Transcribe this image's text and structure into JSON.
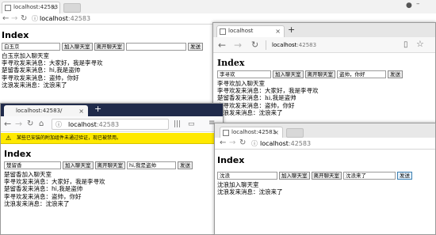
{
  "chrome_window": {
    "tab_title": "localhost:42583",
    "url": {
      "host": "localhost",
      "port": ":42583"
    },
    "page": {
      "title": "Index",
      "input_value": "白玉京",
      "join_label": "加入聊天室",
      "leave_label": "离开聊天室",
      "message_value": "",
      "send_label": "发送",
      "messages": [
        "白玉京加入聊天室",
        "李寻欢发来消息：大家好，我是李寻欢",
        "楚留香发来消息：hi,我是盗帅",
        "李寻欢发来消息：盗帅，你好",
        "沈浪发来消息：沈浪来了"
      ]
    }
  },
  "edge_window": {
    "tab_title": "localhost",
    "url": {
      "host": "localhost",
      "port": ":42583"
    },
    "page": {
      "title": "Index",
      "input_value": "李寻欢",
      "join_label": "加入聊天室",
      "leave_label": "离开聊天室",
      "message_value": "盗帅，你好",
      "send_label": "发送",
      "messages": [
        "李寻欢加入聊天室",
        "李寻欢发来消息：大家好，我是李寻欢",
        "楚留香发来消息：hi,我是盗帅",
        "李寻欢发来消息：盗帅，你好",
        "沈浪发来消息：沈浪来了"
      ]
    }
  },
  "firefox_window": {
    "tab_title": "localhost:42583/",
    "url": {
      "host": "localhost",
      "port": ":42583"
    },
    "notification": "某些已安装的附加组件未通过验证，现已被禁用。",
    "page": {
      "title": "Index",
      "input_value": "楚留香",
      "join_label": "加入聊天室",
      "leave_label": "离开聊天室",
      "message_value": "hi,我是盗帅",
      "send_label": "发送",
      "messages": [
        "楚留香加入聊天室",
        "李寻欢发来消息：大家好，我是李寻欢",
        "楚留香发来消息：hi,我是盗帅",
        "李寻欢发来消息：盗帅，你好",
        "沈浪发来消息：沈浪来了"
      ]
    }
  },
  "chrome_window_2": {
    "tab_title": "localhost:42583",
    "url": {
      "host": "localhost",
      "port": ":42583"
    },
    "page": {
      "title": "Index",
      "input_value": "沈浪",
      "join_label": "加入聊天室",
      "leave_label": "离开聊天室",
      "message_value": "沈浪来了",
      "send_label": "发送",
      "messages": [
        "沈浪加入聊天室",
        "沈浪发来消息：沈浪来了"
      ]
    }
  },
  "colors": {
    "firefox_tab_bar": "#1f2a4a",
    "firefox_notification": "#ffe900",
    "window_border": "#9a9a9a"
  }
}
